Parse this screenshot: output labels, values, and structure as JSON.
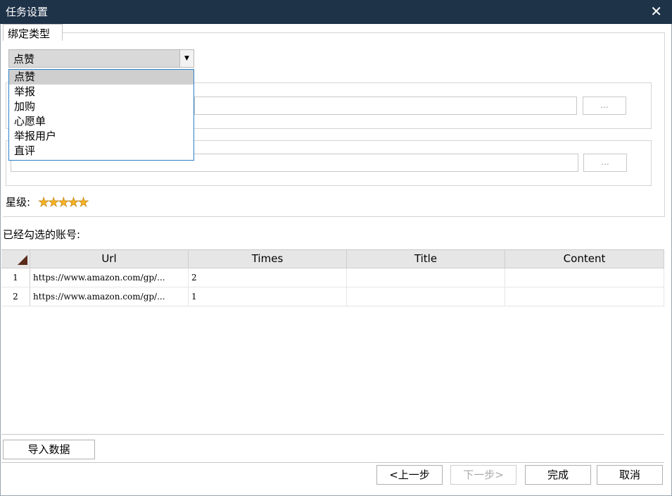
{
  "window": {
    "title": "任务设置",
    "close_symbol": "✕"
  },
  "binding": {
    "group_label": "绑定类型",
    "selected": "点赞",
    "options": [
      "点赞",
      "举报",
      "加购",
      "心愿单",
      "举报用户",
      "直评"
    ]
  },
  "field1": {
    "value": "",
    "browse_label": "..."
  },
  "field2": {
    "value": "",
    "browse_label": "..."
  },
  "rating": {
    "label": "星级:",
    "stars": "★★★★★"
  },
  "accounts": {
    "label": "已经勾选的账号:",
    "columns": [
      "Url",
      "Times",
      "Title",
      "Content"
    ],
    "rows": [
      {
        "num": "1",
        "url": "https://www.amazon.com/gp/...",
        "times": "2",
        "title": "",
        "content": ""
      },
      {
        "num": "2",
        "url": "https://www.amazon.com/gp/...",
        "times": "1",
        "title": "",
        "content": ""
      }
    ]
  },
  "buttons": {
    "import": "导入数据",
    "prev": "<上一步",
    "next": "下一步>",
    "finish": "完成",
    "cancel": "取消"
  }
}
